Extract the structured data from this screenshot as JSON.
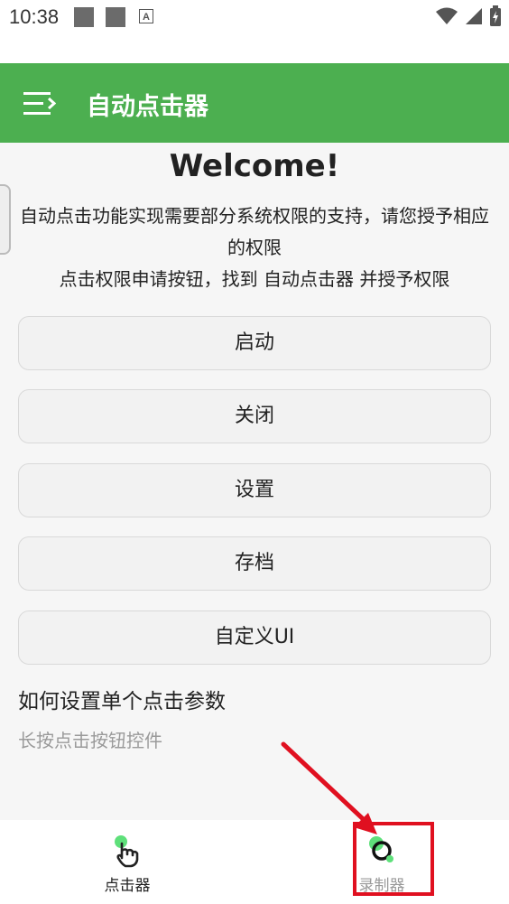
{
  "status_bar": {
    "time": "10:38",
    "icons": [
      "notification-square-icon",
      "notification-square-icon",
      "text-a-icon",
      "wifi-icon",
      "signal-icon",
      "battery-charging-icon"
    ]
  },
  "app_bar": {
    "title": "自动点击器",
    "menu_icon": "menu-icon",
    "color": "#4caf50"
  },
  "main": {
    "welcome": "Welcome!",
    "intro_line1": "自动点击功能实现需要部分系统权限的支持，请您授予相应的权限",
    "intro_line2": "点击权限申请按钮，找到 自动点击器 并授予权限",
    "buttons": [
      {
        "label": "启动"
      },
      {
        "label": "关闭"
      },
      {
        "label": "设置"
      },
      {
        "label": "存档"
      },
      {
        "label": "自定义UI"
      }
    ],
    "help_title": "如何设置单个点击参数",
    "help_subtitle": "长按点击按钮控件"
  },
  "bottom_nav": {
    "items": [
      {
        "label": "点击器",
        "icon": "tap-hand-icon",
        "active": true
      },
      {
        "label": "录制器",
        "icon": "record-icon",
        "active": false
      }
    ]
  },
  "annotation": {
    "color": "#e01020",
    "icons": [
      "red-arrow",
      "highlight-box"
    ]
  }
}
